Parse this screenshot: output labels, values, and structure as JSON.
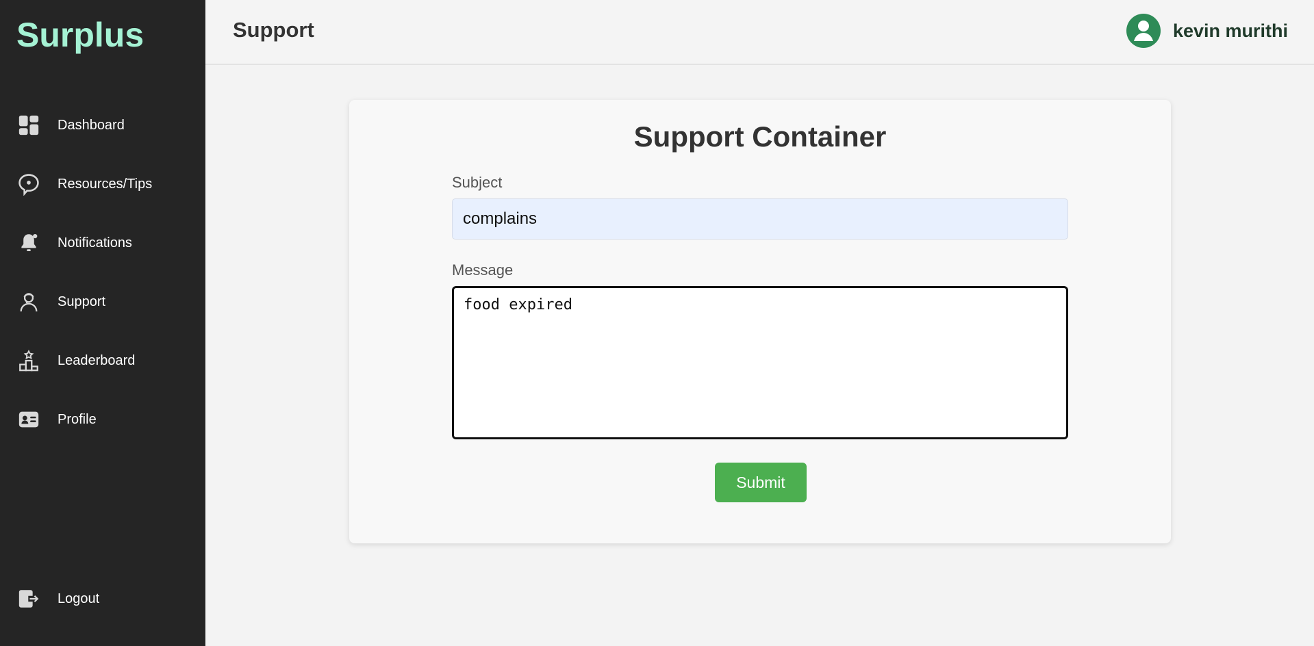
{
  "app": {
    "brand": "Surplus"
  },
  "sidebar": {
    "items": [
      {
        "label": "Dashboard",
        "icon": "dashboard-icon"
      },
      {
        "label": "Resources/Tips",
        "icon": "chat-bubble-icon"
      },
      {
        "label": "Notifications",
        "icon": "bell-icon"
      },
      {
        "label": "Support",
        "icon": "support-agent-icon"
      },
      {
        "label": "Leaderboard",
        "icon": "podium-icon"
      },
      {
        "label": "Profile",
        "icon": "id-card-icon"
      }
    ],
    "logout": {
      "label": "Logout",
      "icon": "logout-icon"
    }
  },
  "header": {
    "title": "Support",
    "user": {
      "name": "kevin murithi",
      "avatar_icon": "user-avatar-icon"
    }
  },
  "support_form": {
    "title": "Support Container",
    "subject": {
      "label": "Subject",
      "value": "complains"
    },
    "message": {
      "label": "Message",
      "value": "food expired"
    },
    "submit_label": "Submit"
  },
  "colors": {
    "sidebar_bg": "#252525",
    "brand": "#a5f2d4",
    "accent_green": "#4caf50",
    "avatar": "#2e8b57",
    "autofill_bg": "#e8f0fe"
  }
}
